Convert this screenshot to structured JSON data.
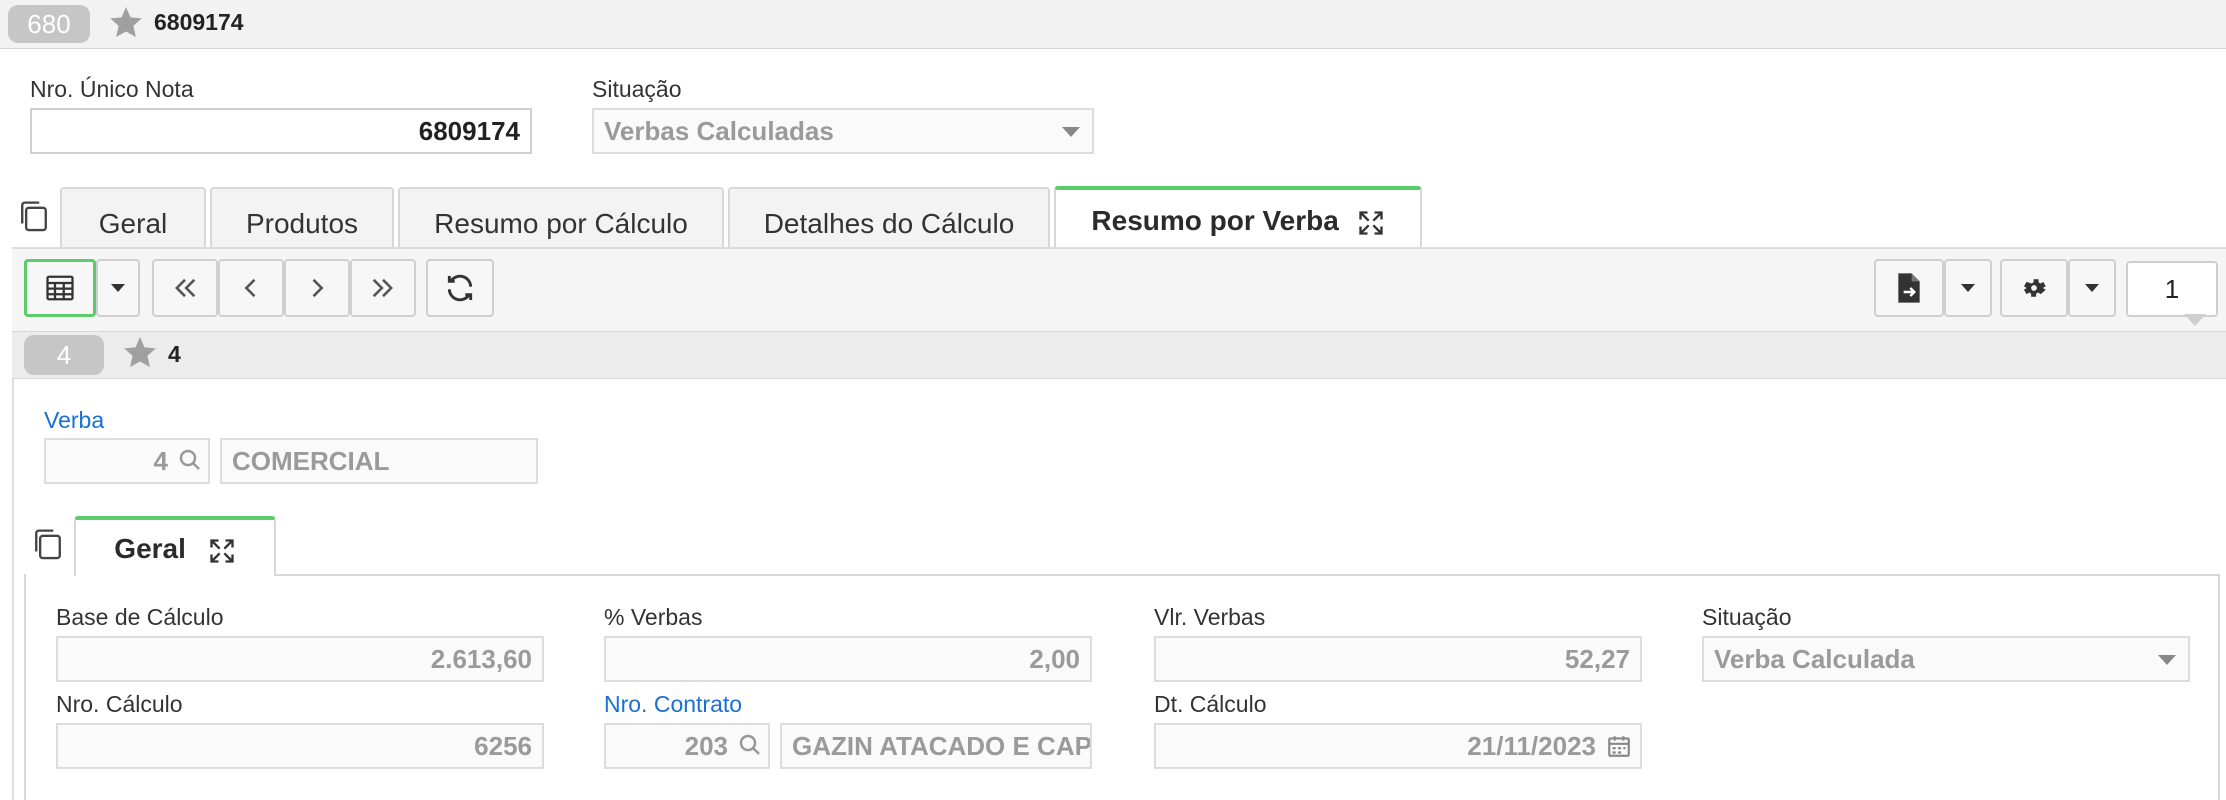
{
  "header": {
    "badge": "680",
    "title": "6809174"
  },
  "form": {
    "nro_unico_label": "Nro. Único Nota",
    "nro_unico_value": "6809174",
    "situacao_label": "Situação",
    "situacao_value": "Verbas Calculadas"
  },
  "tabs": [
    {
      "label": "Geral"
    },
    {
      "label": "Produtos"
    },
    {
      "label": "Resumo por Cálculo"
    },
    {
      "label": "Detalhes do Cálculo"
    },
    {
      "label": "Resumo por Verba"
    }
  ],
  "toolbar": {
    "page_number": "1"
  },
  "record": {
    "badge": "4",
    "title": "4"
  },
  "verba": {
    "label": "Verba",
    "code": "4",
    "name": "COMERCIAL"
  },
  "subtab": {
    "label": "Geral"
  },
  "detail": {
    "base_label": "Base de Cálculo",
    "base_value": "2.613,60",
    "pct_label": "% Verbas",
    "pct_value": "2,00",
    "vlr_label": "Vlr. Verbas",
    "vlr_value": "52,27",
    "sit_label": "Situação",
    "sit_value": "Verba Calculada",
    "nro_calc_label": "Nro. Cálculo",
    "nro_calc_value": "6256",
    "contrato_label": "Nro. Contrato",
    "contrato_code": "203",
    "contrato_name": "GAZIN ATACADO E CAP",
    "dt_label": "Dt. Cálculo",
    "dt_value": "21/11/2023"
  }
}
